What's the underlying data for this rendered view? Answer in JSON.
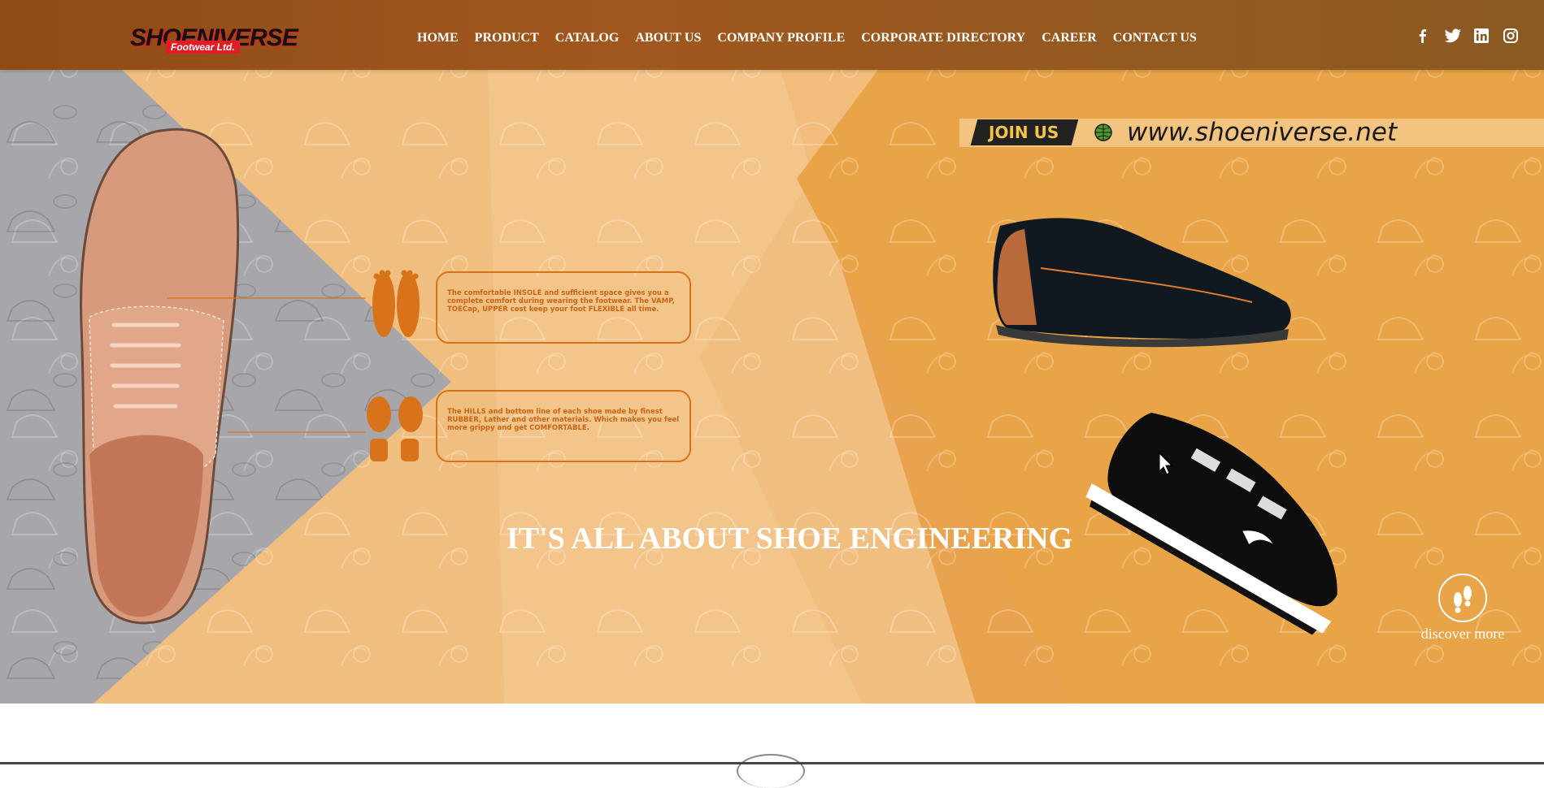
{
  "brand": {
    "logo_main": "SHOENIVERSE",
    "logo_sub": "Footwear Ltd."
  },
  "nav": {
    "items": [
      {
        "label": "HOME"
      },
      {
        "label": "PRODUCT"
      },
      {
        "label": "CATALOG"
      },
      {
        "label": "ABOUT US"
      },
      {
        "label": "COMPANY PROFILE"
      },
      {
        "label": "CORPORATE DIRECTORY"
      },
      {
        "label": "CAREER"
      },
      {
        "label": "CONTACT US"
      }
    ]
  },
  "social": [
    "facebook-icon",
    "twitter-icon",
    "linkedin-icon",
    "instagram-icon"
  ],
  "hero": {
    "join_label": "JOIN US",
    "url": "www.shoeniverse.net",
    "callout_1": "The comfortable INSOLE and sufficient space gives you a complete comfort during wearing the footwear. The VAMP, TOECap, UPPER cost keep your foot FLEXIBLE all time.",
    "callout_2": "The HILLS and bottom line of each shoe made by finest RUBBER, Lather and other materials. Which makes you feel more grippy and get COMFORTABLE.",
    "tagline": "IT'S ALL ABOUT SHOE ENGINEERING",
    "discover_label": "discover more"
  },
  "colors": {
    "nav_bg": "#8f4a16",
    "hero_orange": "#e9a34f",
    "accent": "#d9731a",
    "gray_panel": "#a7a6aa"
  }
}
